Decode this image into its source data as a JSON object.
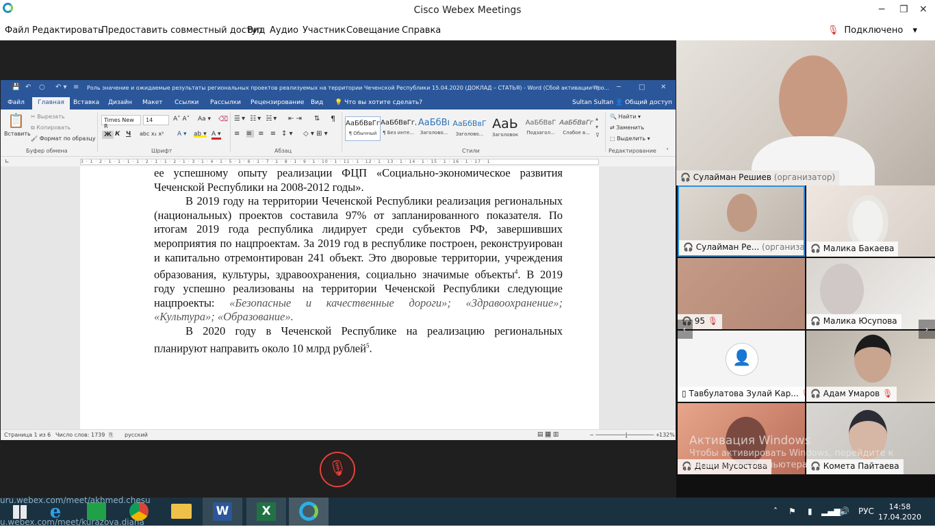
{
  "window": {
    "title": "Cisco Webex Meetings",
    "minimize": "─",
    "maximize": "❐",
    "close": "✕"
  },
  "menu": [
    "Файл",
    "Редактировать",
    "Предоставить совместный доступ",
    "Вид",
    "Аудио",
    "Участник",
    "Совещание",
    "Справка"
  ],
  "connection": {
    "status": "Подключено",
    "chevron": "▾"
  },
  "word": {
    "title": "Роль значение и ожидаемые результаты региональных проектов реализуемых на территории Чеченской Республики 15.04.2020 (ДОКЛАД  – СТАТЬЯ) - Word (Сбой активации про...",
    "tabs": [
      "Файл",
      "Главная",
      "Вставка",
      "Дизайн",
      "Макет",
      "Ссылки",
      "Рассылки",
      "Рецензирование",
      "Вид"
    ],
    "tell_me": "Что вы хотите сделать?",
    "user": "Sultan Sultan",
    "share": "Общий доступ",
    "clipboard": {
      "paste": "Вставить",
      "cut": "Вырезать",
      "copy": "Копировать",
      "format": "Формат по образцу",
      "label": "Буфер обмена"
    },
    "font": {
      "name": "Times New R",
      "size": "14",
      "label": "Шрифт",
      "bold": "Ж",
      "italic": "К",
      "underline": "Ч"
    },
    "paragraph": {
      "label": "Абзац"
    },
    "styles": {
      "label": "Стили",
      "items": [
        {
          "preview": "АаБбВвГг,",
          "name": "¶ Обычный"
        },
        {
          "preview": "АаБбВвГг,",
          "name": "¶ Без инте..."
        },
        {
          "preview": "АаБбВı",
          "name": "Заголово..."
        },
        {
          "preview": "АаБбВвГ",
          "name": "Заголово..."
        },
        {
          "preview": "АаЬ",
          "name": "Заголовок"
        },
        {
          "preview": "АаБбВвГ",
          "name": "Подзагол..."
        },
        {
          "preview": "АаБбВвГг",
          "name": "Слабое в..."
        }
      ]
    },
    "editing": {
      "find": "Найти",
      "replace": "Заменить",
      "select": "Выделить",
      "label": "Редактирование"
    },
    "ruler": "3 · 1 · 2 · 1 · 1 · 1 · 1 · 2 · 1 · 1 · 2 · 1 · 3 · 1 · 4 · 1 · 5 · 1 · 6 · 1 · 7 · 1 · 8 · 1 · 9 · 1 · 10 · 1 · 11 · 1 · 12 · 1 · 13 · 1 · 14 · 1 · 15 · 1 · 16 · 1 · 17 · 1",
    "doc": {
      "p1": "ее успешному опыту реализации ФЦП «Социально-экономическое развития Чеченской Республики на 2008-2012 годы».",
      "p2a": "В 2019 году на территории Чеченской Республики реализация региональных (национальных) проектов составила 97% от запланированного показателя. По итогам 2019 года республика лидирует среди субъектов РФ, завершивших мероприятия по нацпроектам. За 2019 год в республике построен, реконструирован и капитально отремонтирован 241 объект. Это дворовые территории, учреждения образования, культуры, здравоохранения, социально значимые объекты",
      "sup4": "4",
      "p2b": ".  В 2019 году успешно реализованы на территории Чеченской Республики следующие нацпроекты: ",
      "p2it": "«Безопасные и качественные дороги»; «Здравоохранение»; «Культура»; «Образование».",
      "p3": "В 2020 году в Чеченской Республике на реализацию региональных планируют направить около 10 млрд рублей",
      "sup5": "5",
      "p3end": "."
    },
    "status": {
      "page": "Страница 1 из 6",
      "words": "Число слов: 1739",
      "lang": "русский",
      "zoom": "132%"
    }
  },
  "participants": {
    "main": {
      "name": "Сулайман Решиев",
      "role": "(организатор)"
    },
    "tiles": [
      {
        "name": "Сулайман Ре...",
        "role": "(организатор)",
        "muted": false
      },
      {
        "name": "Малика Бакаева",
        "role": "",
        "muted": false
      },
      {
        "name": "95",
        "role": "",
        "muted": true
      },
      {
        "name": "Малика Юсупова",
        "role": "",
        "muted": false
      },
      {
        "name": "Тавбулатова Зулай Кар...",
        "role": "",
        "muted": true
      },
      {
        "name": "Адам Умаров",
        "role": "",
        "muted": true
      },
      {
        "name": "Дещи Мусостова",
        "role": "",
        "muted": false
      },
      {
        "name": "Комета Пайтаева",
        "role": "",
        "muted": false
      }
    ]
  },
  "activation": {
    "title": "Активация Windows",
    "sub": "Чтобы активировать Windows, перейдите к параметрам компьютера."
  },
  "overlay_urls": [
    "uru.webex.com/meet/akhmed.chesu",
    "u.webex.com/meet/kurazova.diana"
  ],
  "tray": {
    "lang": "РУС",
    "time": "14:58",
    "date": "17.04.2020"
  },
  "colors": {
    "word_blue": "#2b579a",
    "mute_red": "#e4433a",
    "taskbar": "#1a3140"
  }
}
